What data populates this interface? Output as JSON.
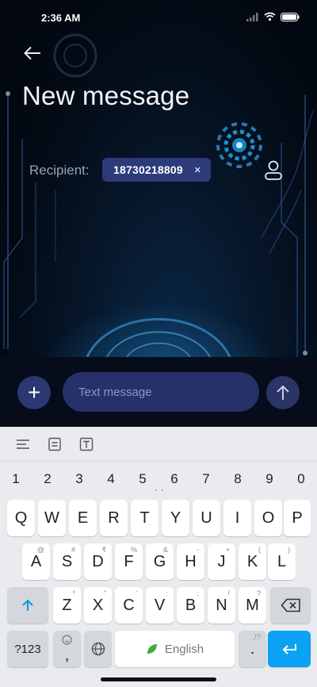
{
  "status": {
    "time": "2:36 AM"
  },
  "header": {
    "title": "New message"
  },
  "recipient": {
    "label": "Recipient:",
    "number": "18730218809",
    "remove_glyph": "×"
  },
  "compose": {
    "add_glyph": "+",
    "placeholder": "Text message"
  },
  "keyboard": {
    "numbers": [
      "1",
      "2",
      "3",
      "4",
      "5",
      "6",
      "7",
      "8",
      "9",
      "0"
    ],
    "row1": [
      "Q",
      "W",
      "E",
      "R",
      "T",
      "Y",
      "U",
      "I",
      "O",
      "P"
    ],
    "row2": [
      {
        "key": "A",
        "sub": "@"
      },
      {
        "key": "S",
        "sub": "#"
      },
      {
        "key": "D",
        "sub": "₹"
      },
      {
        "key": "F",
        "sub": "%"
      },
      {
        "key": "G",
        "sub": "&"
      },
      {
        "key": "H",
        "sub": "-"
      },
      {
        "key": "J",
        "sub": "+"
      },
      {
        "key": "K",
        "sub": "("
      },
      {
        "key": "L",
        "sub": ")"
      }
    ],
    "row3": [
      {
        "key": "Z",
        "sub": "*"
      },
      {
        "key": "X",
        "sub": "\""
      },
      {
        "key": "C",
        "sub": "'"
      },
      {
        "key": "V",
        "sub": ":"
      },
      {
        "key": "B",
        "sub": ";"
      },
      {
        "key": "N",
        "sub": "!"
      },
      {
        "key": "M",
        "sub": "?"
      }
    ],
    "symbols_label": "?123",
    "comma": ",",
    "space_label": "English",
    "period": ".",
    "period_sub": ",!?"
  },
  "colors": {
    "accent": "#0aa2f2",
    "chip": "#2e3b7a",
    "input": "#26306a"
  }
}
